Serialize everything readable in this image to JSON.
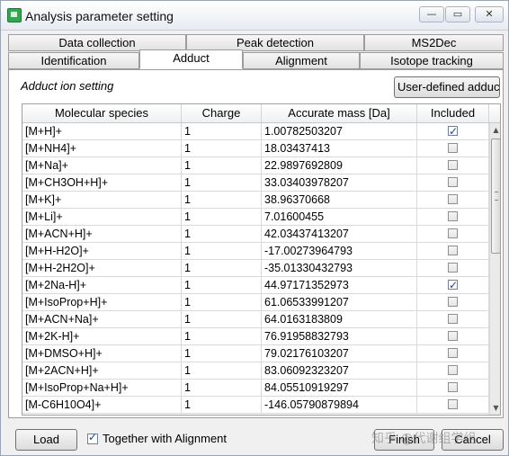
{
  "window": {
    "title": "Analysis parameter setting",
    "controls": {
      "minimize": "—",
      "maximize": "▭",
      "close": "✕"
    }
  },
  "tabs_back": [
    "Data collection",
    "Peak detection",
    "MS2Dec"
  ],
  "tabs_front": [
    "Identification",
    "Adduct",
    "Alignment",
    "Isotope tracking"
  ],
  "active_tab": "Adduct",
  "section": {
    "label": "Adduct ion setting",
    "user_defined_button": "User-defined adduct"
  },
  "grid": {
    "columns": [
      "Molecular species",
      "Charge",
      "Accurate mass [Da]",
      "Included"
    ],
    "rows": [
      {
        "species": "[M+H]+",
        "charge": "1",
        "mass": "1.00782503207",
        "included": true
      },
      {
        "species": "[M+NH4]+",
        "charge": "1",
        "mass": "18.03437413",
        "included": false
      },
      {
        "species": "[M+Na]+",
        "charge": "1",
        "mass": "22.9897692809",
        "included": false
      },
      {
        "species": "[M+CH3OH+H]+",
        "charge": "1",
        "mass": "33.03403978207",
        "included": false
      },
      {
        "species": "[M+K]+",
        "charge": "1",
        "mass": "38.96370668",
        "included": false
      },
      {
        "species": "[M+Li]+",
        "charge": "1",
        "mass": "7.01600455",
        "included": false
      },
      {
        "species": "[M+ACN+H]+",
        "charge": "1",
        "mass": "42.03437413207",
        "included": false
      },
      {
        "species": "[M+H-H2O]+",
        "charge": "1",
        "mass": "-17.00273964793",
        "included": false
      },
      {
        "species": "[M+H-2H2O]+",
        "charge": "1",
        "mass": "-35.01330432793",
        "included": false
      },
      {
        "species": "[M+2Na-H]+",
        "charge": "1",
        "mass": "44.97171352973",
        "included": true
      },
      {
        "species": "[M+IsoProp+H]+",
        "charge": "1",
        "mass": "61.06533991207",
        "included": false
      },
      {
        "species": "[M+ACN+Na]+",
        "charge": "1",
        "mass": "64.0163183809",
        "included": false
      },
      {
        "species": "[M+2K-H]+",
        "charge": "1",
        "mass": "76.91958832793",
        "included": false
      },
      {
        "species": "[M+DMSO+H]+",
        "charge": "1",
        "mass": "79.02176103207",
        "included": false
      },
      {
        "species": "[M+2ACN+H]+",
        "charge": "1",
        "mass": "83.06092323207",
        "included": false
      },
      {
        "species": "[M+IsoProp+Na+H]+",
        "charge": "1",
        "mass": "84.05510919297",
        "included": false
      },
      {
        "species": "[M-C6H10O4]+",
        "charge": "1",
        "mass": "-146.05790879894",
        "included": false
      }
    ]
  },
  "footer": {
    "load_button": "Load",
    "together_label": "Together with Alignment",
    "together_checked": true,
    "finish_button": "Finish",
    "cancel_button": "Cancel",
    "watermark": "知乎 @代谢组学组"
  }
}
